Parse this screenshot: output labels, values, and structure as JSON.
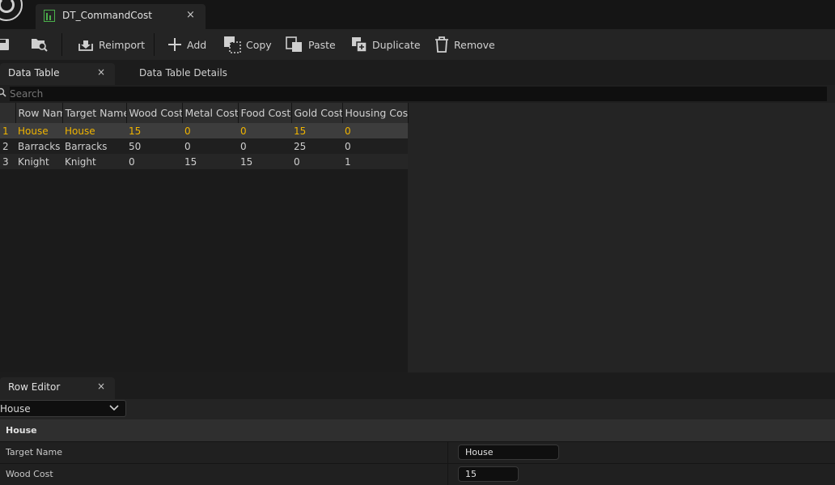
{
  "document_tab": {
    "title": "DT_CommandCost",
    "close": "×"
  },
  "toolbar": {
    "reimport": "Reimport",
    "add": "Add",
    "copy": "Copy",
    "paste": "Paste",
    "duplicate": "Duplicate",
    "remove": "Remove"
  },
  "panel_tabs": {
    "data_table": "Data Table",
    "data_table_close": "×",
    "data_table_details": "Data Table Details"
  },
  "search": {
    "placeholder": "Search"
  },
  "table": {
    "columns": [
      "",
      "Row Name",
      "Target Name",
      "Wood Cost",
      "Metal Cost",
      "Food Cost",
      "Gold Cost",
      "Housing Cost"
    ],
    "rows": [
      [
        "1",
        "House",
        "House",
        "15",
        "0",
        "0",
        "15",
        "0"
      ],
      [
        "2",
        "Barracks",
        "Barracks",
        "50",
        "0",
        "0",
        "25",
        "0"
      ],
      [
        "3",
        "Knight",
        "Knight",
        "0",
        "15",
        "15",
        "0",
        "1"
      ]
    ],
    "selected_row": 0
  },
  "row_editor": {
    "tab_label": "Row Editor",
    "tab_close": "×",
    "selected_row": "House",
    "header": "House",
    "properties": [
      {
        "label": "Target Name",
        "value": "House"
      },
      {
        "label": "Wood Cost",
        "value": "15"
      }
    ]
  }
}
